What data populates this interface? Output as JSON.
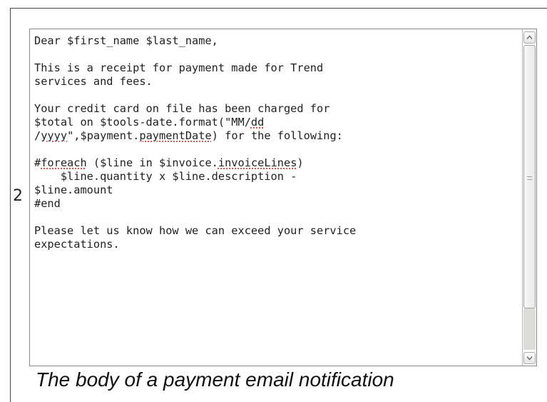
{
  "row_number": "2",
  "caption": "The body of a payment email notification",
  "email_body": {
    "lines": [
      [
        {
          "t": "Dear $first_name $last_name,"
        }
      ],
      [
        {
          "t": ""
        }
      ],
      [
        {
          "t": "This is a receipt for payment made for Trend"
        }
      ],
      [
        {
          "t": "services and fees."
        }
      ],
      [
        {
          "t": ""
        }
      ],
      [
        {
          "t": "Your credit card on file has been charged for"
        }
      ],
      [
        {
          "t": "$total on $tools-date.format(\"MM/"
        },
        {
          "t": "dd",
          "spell": true
        }
      ],
      [
        {
          "t": "/"
        },
        {
          "t": "yyyy",
          "spell": true
        },
        {
          "t": "\",$payment."
        },
        {
          "t": "paymentDate",
          "spell": true
        },
        {
          "t": ") for the following:"
        }
      ],
      [
        {
          "t": ""
        }
      ],
      [
        {
          "t": "#"
        },
        {
          "t": "foreach",
          "spell": true
        },
        {
          "t": " ($line in $invoice."
        },
        {
          "t": "invoiceLines",
          "spell": true
        },
        {
          "t": ")"
        }
      ],
      [
        {
          "t": "    $line.quantity x $line.description -"
        }
      ],
      [
        {
          "t": "$line.amount"
        }
      ],
      [
        {
          "t": "#end"
        }
      ],
      [
        {
          "t": ""
        }
      ],
      [
        {
          "t": "Please let us know how we can exceed your service"
        }
      ],
      [
        {
          "t": "expectations."
        }
      ]
    ]
  },
  "scrollbar": {
    "up_icon": "chevron-up-icon",
    "down_icon": "chevron-down-icon",
    "thumb_start_fraction": 0.0,
    "thumb_end_fraction": 0.865
  },
  "colors": {
    "spellcheck_underline": "#d02020",
    "track_fill": "#dcdcd8"
  }
}
